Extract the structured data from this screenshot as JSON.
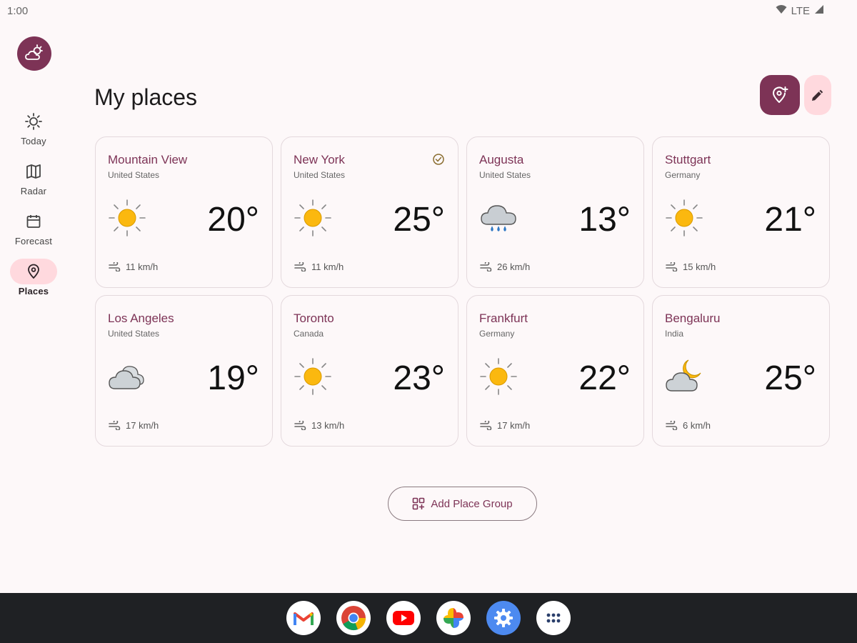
{
  "status": {
    "time": "1:00",
    "network": "LTE"
  },
  "rail": {
    "items": [
      {
        "label": "Today",
        "icon": "sun-outline-icon"
      },
      {
        "label": "Radar",
        "icon": "map-icon"
      },
      {
        "label": "Forecast",
        "icon": "calendar-icon"
      },
      {
        "label": "Places",
        "icon": "location-pin-icon"
      }
    ],
    "active": "Places"
  },
  "header": {
    "title": "My places"
  },
  "places": [
    {
      "city": "Mountain View",
      "country": "United States",
      "temp": "20°",
      "wind": "11 km/h",
      "condition": "sunny"
    },
    {
      "city": "New York",
      "country": "United States",
      "temp": "25°",
      "wind": "11 km/h",
      "condition": "sunny",
      "current": true
    },
    {
      "city": "Augusta",
      "country": "United States",
      "temp": "13°",
      "wind": "26 km/h",
      "condition": "rain"
    },
    {
      "city": "Stuttgart",
      "country": "Germany",
      "temp": "21°",
      "wind": "15 km/h",
      "condition": "sunny"
    },
    {
      "city": "Los Angeles",
      "country": "United States",
      "temp": "19°",
      "wind": "17 km/h",
      "condition": "cloudy"
    },
    {
      "city": "Toronto",
      "country": "Canada",
      "temp": "23°",
      "wind": "13 km/h",
      "condition": "sunny"
    },
    {
      "city": "Frankfurt",
      "country": "Germany",
      "temp": "22°",
      "wind": "17 km/h",
      "condition": "sunny"
    },
    {
      "city": "Bengaluru",
      "country": "India",
      "temp": "25°",
      "wind": "6 km/h",
      "condition": "partly-cloudy-night"
    }
  ],
  "actions": {
    "add_group": "Add Place Group"
  },
  "colors": {
    "accent": "#7d3356",
    "accent_container": "#ffd9de",
    "sun": "#fbb80f"
  },
  "taskbar": {
    "apps": [
      "gmail-icon",
      "chrome-icon",
      "youtube-icon",
      "photos-icon",
      "settings-icon",
      "app-drawer-icon"
    ]
  }
}
